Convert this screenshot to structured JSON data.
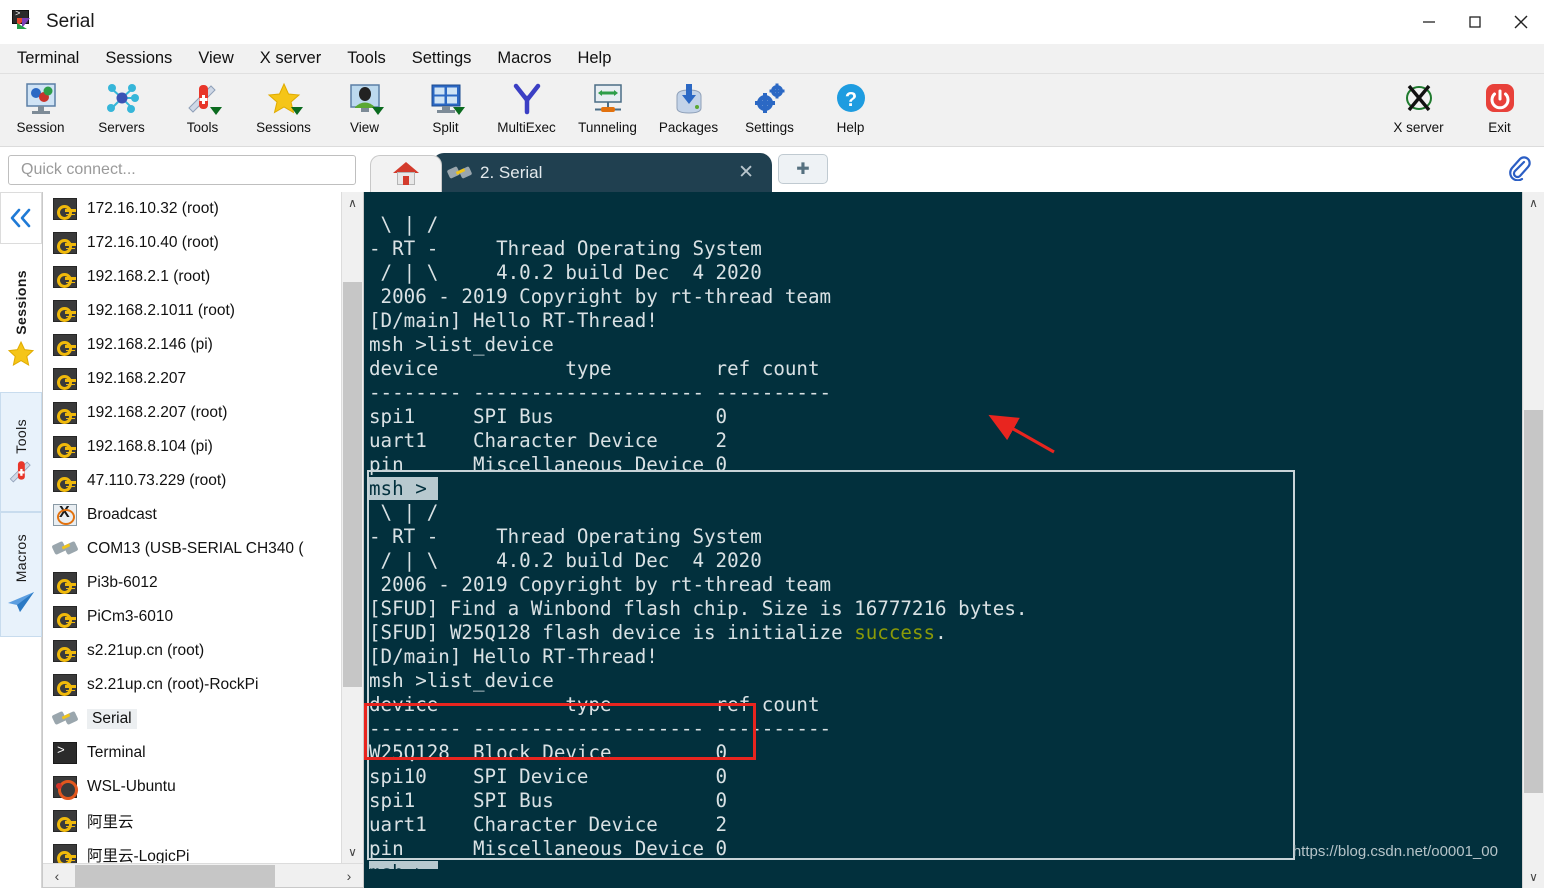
{
  "window": {
    "title": "Serial",
    "app_icon": "mobaxterm-icon",
    "minimize": "—",
    "maximize": "☐",
    "close": "✕"
  },
  "menu": {
    "items": [
      {
        "label": "Terminal"
      },
      {
        "label": "Sessions"
      },
      {
        "label": "View"
      },
      {
        "label": "X server"
      },
      {
        "label": "Tools"
      },
      {
        "label": "Settings"
      },
      {
        "label": "Macros"
      },
      {
        "label": "Help"
      }
    ]
  },
  "toolbar": {
    "left": [
      {
        "label": "Session",
        "icon": "session-icon",
        "caret": false
      },
      {
        "label": "Servers",
        "icon": "servers-icon",
        "caret": false
      },
      {
        "label": "Tools",
        "icon": "tools-knife-icon",
        "caret": true
      },
      {
        "label": "Sessions",
        "icon": "star-icon",
        "caret": true
      },
      {
        "label": "View",
        "icon": "view-monitor-icon",
        "caret": true
      },
      {
        "label": "Split",
        "icon": "split-grid-icon",
        "caret": true
      },
      {
        "label": "MultiExec",
        "icon": "multiexec-fork-icon",
        "caret": false
      },
      {
        "label": "Tunneling",
        "icon": "tunneling-icon",
        "caret": false
      },
      {
        "label": "Packages",
        "icon": "packages-download-icon",
        "caret": false
      },
      {
        "label": "Settings",
        "icon": "settings-gear-icon",
        "caret": false
      },
      {
        "label": "Help",
        "icon": "help-question-icon",
        "caret": false
      }
    ],
    "right": [
      {
        "label": "X server",
        "icon": "x-server-icon",
        "caret": false
      },
      {
        "label": "Exit",
        "icon": "exit-power-icon",
        "caret": false
      }
    ]
  },
  "quick_connect": {
    "placeholder": "Quick connect...",
    "value": ""
  },
  "tabs": {
    "home_icon": "home-icon",
    "items": [
      {
        "label": "2. Serial",
        "icon": "plug-icon",
        "active": true,
        "close": "✕"
      }
    ],
    "new_tab": "✚",
    "attach_icon": "paperclip-icon"
  },
  "side_tabs": [
    {
      "label": "Sessions",
      "icon": "star-icon"
    },
    {
      "label": "Tools",
      "icon": "knife-icon"
    },
    {
      "label": "Macros",
      "icon": "paperplane-icon"
    }
  ],
  "sidebar": {
    "collapse_icon": "double-chevron-left-icon",
    "scroll_up": "∧",
    "scroll_down": "∨",
    "scroll_left": "‹",
    "scroll_right": "›",
    "sessions": [
      {
        "label": "172.16.10.32 (root)",
        "icon": "key-icon",
        "selected": false
      },
      {
        "label": "172.16.10.40 (root)",
        "icon": "key-icon",
        "selected": false
      },
      {
        "label": "192.168.2.1 (root)",
        "icon": "key-icon",
        "selected": false
      },
      {
        "label": "192.168.2.1011 (root)",
        "icon": "key-icon",
        "selected": false
      },
      {
        "label": "192.168.2.146 (pi)",
        "icon": "key-icon",
        "selected": false
      },
      {
        "label": "192.168.2.207",
        "icon": "key-icon",
        "selected": false
      },
      {
        "label": "192.168.2.207 (root)",
        "icon": "key-icon",
        "selected": false
      },
      {
        "label": "192.168.8.104 (pi)",
        "icon": "key-icon",
        "selected": false
      },
      {
        "label": "47.110.73.229 (root)",
        "icon": "key-icon",
        "selected": false
      },
      {
        "label": "Broadcast",
        "icon": "x-server-icon",
        "selected": false
      },
      {
        "label": "COM13  (USB-SERIAL CH340 (",
        "icon": "plug-icon",
        "selected": false
      },
      {
        "label": "Pi3b-6012",
        "icon": "key-icon",
        "selected": false
      },
      {
        "label": "PiCm3-6010",
        "icon": "key-icon",
        "selected": false
      },
      {
        "label": "s2.21up.cn (root)",
        "icon": "key-icon",
        "selected": false
      },
      {
        "label": "s2.21up.cn (root)-RockPi",
        "icon": "key-icon",
        "selected": false
      },
      {
        "label": "Serial",
        "icon": "plug-icon",
        "selected": true
      },
      {
        "label": "Terminal",
        "icon": "terminal-icon",
        "selected": false
      },
      {
        "label": "WSL-Ubuntu",
        "icon": "ubuntu-icon",
        "selected": false
      },
      {
        "label": "阿里云",
        "icon": "key-icon",
        "selected": false
      },
      {
        "label": "阿里云-LogicPi",
        "icon": "key-icon",
        "selected": false
      }
    ]
  },
  "terminal": {
    "background": "#02303d",
    "foreground": "#d9e1e4",
    "success_color": "#8a9a08",
    "lines_top": [
      " \\ | /",
      "- RT -     Thread Operating System",
      " / | \\     4.0.2 build Dec  4 2020",
      " 2006 - 2019 Copyright by rt-thread team",
      "[D/main] Hello RT-Thread!",
      "msh >list_device",
      "device           type         ref count",
      "-------- -------------------- ----------",
      "spi1     SPI Bus              0",
      "uart1    Character Device     2",
      "pin      Miscellaneous Device 0",
      "msh > "
    ],
    "lines_bottom": [
      " \\ | /",
      "- RT -     Thread Operating System",
      " / | \\     4.0.2 build Dec  4 2020",
      " 2006 - 2019 Copyright by rt-thread team",
      "[SFUD] Find a Winbond flash chip. Size is 16777216 bytes.",
      "[SFUD] W25Q128 flash device is initialize ",
      "[D/main] Hello RT-Thread!",
      "msh >list_device",
      "device           type         ref count",
      "-------- -------------------- ----------",
      "W25Q128  Block Device         0",
      "spi10    SPI Device           0",
      "spi1     SPI Bus              0",
      "uart1    Character Device     2",
      "pin      Miscellaneous Device 0",
      "msh > "
    ],
    "success_word": "success",
    "success_tail": ".",
    "prompt_last": "msh > ",
    "watermark": "https://blog.csdn.net/o0001_00",
    "annotations": {
      "white_box": "highlight-second-boot-output",
      "red_box": "highlight-new-spi-devices",
      "red_arrow": "points-to-success"
    },
    "device_table": {
      "headers": [
        "device",
        "type",
        "ref count"
      ],
      "rows_top": [
        [
          "spi1",
          "SPI Bus",
          "0"
        ],
        [
          "uart1",
          "Character Device",
          "2"
        ],
        [
          "pin",
          "Miscellaneous Device",
          "0"
        ]
      ],
      "rows_bottom": [
        [
          "W25Q128",
          "Block Device",
          "0"
        ],
        [
          "spi10",
          "SPI Device",
          "0"
        ],
        [
          "spi1",
          "SPI Bus",
          "0"
        ],
        [
          "uart1",
          "Character Device",
          "2"
        ],
        [
          "pin",
          "Miscellaneous Device",
          "0"
        ]
      ]
    },
    "scroll_up": "∧",
    "scroll_down": "∨"
  }
}
